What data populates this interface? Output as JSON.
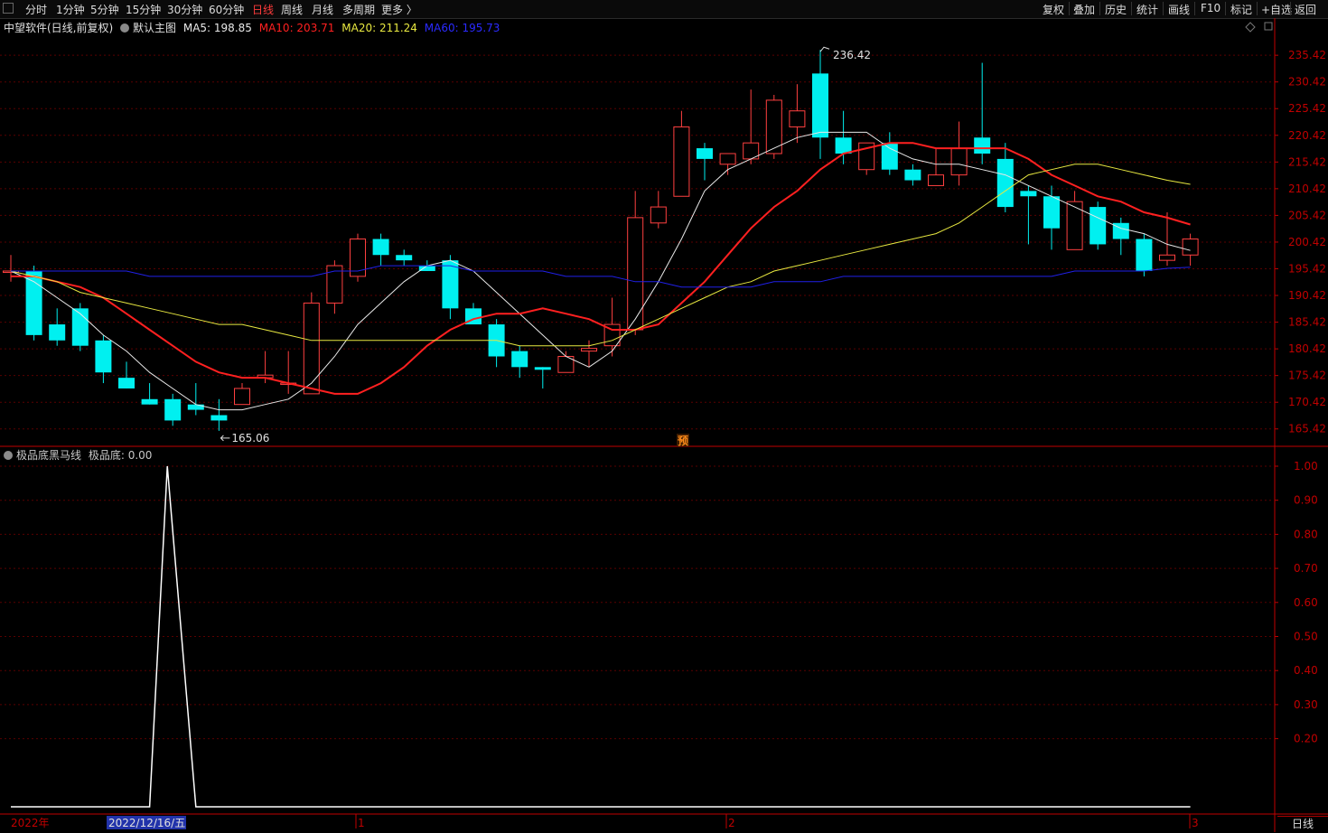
{
  "toolbar": {
    "periods": [
      "分时",
      "1分钟",
      "5分钟",
      "15分钟",
      "30分钟",
      "60分钟",
      "日线",
      "周线",
      "月线",
      "多周期",
      "更多 〉"
    ],
    "active_period": "日线",
    "tools": [
      "复权",
      "叠加",
      "历史",
      "统计",
      "画线",
      "F10",
      "标记",
      "+自选",
      "返回"
    ]
  },
  "info": {
    "stock": "中望软件(日线,前复权)",
    "template": "默认主图",
    "ma5": "MA5: 198.85",
    "ma10": "MA10: 203.71",
    "ma20": "MA20: 211.24",
    "ma60": "MA60: 195.73"
  },
  "indicator": {
    "name": "极品底黑马线",
    "value": "极品底: 0.00"
  },
  "colors": {
    "up": "#ff4040",
    "down": "#00f0f0",
    "ma5": "#e8e8e8",
    "ma10": "#ff2020",
    "ma20": "#e8e840",
    "ma60": "#2020e8",
    "axis": "#c00000"
  },
  "chart_data": [
    {
      "type": "candlestick",
      "title": "中望软件(日线,前复权)",
      "yaxis_ticks": [
        "235.42",
        "230.42",
        "225.42",
        "220.42",
        "215.42",
        "210.42",
        "205.42",
        "200.42",
        "195.42",
        "190.42",
        "185.42",
        "180.42",
        "175.42",
        "170.42",
        "165.42"
      ],
      "ylim": [
        162.5,
        239
      ],
      "annotations": {
        "high_label": "236.42",
        "low_label": "165.06",
        "pre_marker": "预"
      },
      "candles": [
        {
          "o": 195,
          "h": 198,
          "l": 193,
          "c": 195
        },
        {
          "o": 195,
          "h": 196,
          "l": 182,
          "c": 183
        },
        {
          "o": 185,
          "h": 188,
          "l": 181,
          "c": 182
        },
        {
          "o": 188,
          "h": 189,
          "l": 180,
          "c": 181
        },
        {
          "o": 182,
          "h": 183,
          "l": 174,
          "c": 176
        },
        {
          "o": 175,
          "h": 178,
          "l": 173,
          "c": 173
        },
        {
          "o": 171,
          "h": 174,
          "l": 170,
          "c": 170
        },
        {
          "o": 171,
          "h": 172,
          "l": 166,
          "c": 167
        },
        {
          "o": 170,
          "h": 174,
          "l": 168,
          "c": 169
        },
        {
          "o": 168,
          "h": 171,
          "l": 165.06,
          "c": 167
        },
        {
          "o": 170,
          "h": 174,
          "l": 170,
          "c": 173
        },
        {
          "o": 175,
          "h": 180,
          "l": 174,
          "c": 175.5
        },
        {
          "o": 174,
          "h": 180,
          "l": 172,
          "c": 174
        },
        {
          "o": 172,
          "h": 191,
          "l": 172,
          "c": 189
        },
        {
          "o": 189,
          "h": 197,
          "l": 187,
          "c": 196
        },
        {
          "o": 194,
          "h": 202,
          "l": 193,
          "c": 201
        },
        {
          "o": 201,
          "h": 202,
          "l": 196,
          "c": 198
        },
        {
          "o": 198,
          "h": 199,
          "l": 196,
          "c": 197
        },
        {
          "o": 196,
          "h": 197,
          "l": 195,
          "c": 195
        },
        {
          "o": 197,
          "h": 198,
          "l": 186,
          "c": 188
        },
        {
          "o": 188,
          "h": 189,
          "l": 185,
          "c": 185
        },
        {
          "o": 185,
          "h": 186,
          "l": 177,
          "c": 179
        },
        {
          "o": 180,
          "h": 181,
          "l": 175,
          "c": 177
        },
        {
          "o": 177,
          "h": 177,
          "l": 173,
          "c": 176.5
        },
        {
          "o": 176,
          "h": 180,
          "l": 176,
          "c": 179
        },
        {
          "o": 180,
          "h": 182,
          "l": 177,
          "c": 180.5
        },
        {
          "o": 181,
          "h": 190,
          "l": 179,
          "c": 185
        },
        {
          "o": 184,
          "h": 210,
          "l": 183,
          "c": 205
        },
        {
          "o": 204,
          "h": 210,
          "l": 203,
          "c": 207
        },
        {
          "o": 209,
          "h": 225,
          "l": 209,
          "c": 222
        },
        {
          "o": 218,
          "h": 219,
          "l": 212,
          "c": 216
        },
        {
          "o": 215,
          "h": 217,
          "l": 213,
          "c": 217
        },
        {
          "o": 216,
          "h": 229,
          "l": 215,
          "c": 219
        },
        {
          "o": 217,
          "h": 228,
          "l": 216,
          "c": 227
        },
        {
          "o": 222,
          "h": 230,
          "l": 219,
          "c": 225
        },
        {
          "o": 232,
          "h": 236.42,
          "l": 216,
          "c": 220
        },
        {
          "o": 220,
          "h": 225,
          "l": 215,
          "c": 217
        },
        {
          "o": 214,
          "h": 219,
          "l": 213,
          "c": 219
        },
        {
          "o": 219,
          "h": 221,
          "l": 213,
          "c": 214
        },
        {
          "o": 214,
          "h": 215,
          "l": 211,
          "c": 212
        },
        {
          "o": 211,
          "h": 218,
          "l": 211,
          "c": 213
        },
        {
          "o": 213,
          "h": 223,
          "l": 211,
          "c": 218
        },
        {
          "o": 220,
          "h": 234,
          "l": 215,
          "c": 217
        },
        {
          "o": 216,
          "h": 219,
          "l": 206,
          "c": 207
        },
        {
          "o": 210,
          "h": 211,
          "l": 200,
          "c": 209
        },
        {
          "o": 209,
          "h": 211,
          "l": 199,
          "c": 203
        },
        {
          "o": 199,
          "h": 210,
          "l": 199,
          "c": 208
        },
        {
          "o": 207,
          "h": 208,
          "l": 199,
          "c": 200
        },
        {
          "o": 204,
          "h": 205,
          "l": 198,
          "c": 201
        },
        {
          "o": 201,
          "h": 202,
          "l": 194,
          "c": 195
        },
        {
          "o": 197,
          "h": 206,
          "l": 196,
          "c": 198
        },
        {
          "o": 198,
          "h": 202,
          "l": 196,
          "c": 201
        }
      ],
      "series": [
        {
          "name": "MA5",
          "values": [
            195,
            193,
            190,
            187,
            183,
            180,
            176,
            173,
            170,
            169,
            169,
            170,
            171,
            174,
            179,
            185,
            189,
            193,
            196,
            197,
            195,
            191,
            187,
            183,
            179,
            177,
            180,
            186,
            193,
            201,
            210,
            214,
            216,
            218,
            220,
            221,
            221,
            221,
            218,
            216,
            215,
            215,
            214,
            213,
            211,
            209,
            207,
            205,
            203,
            202,
            200,
            198.85
          ]
        },
        {
          "name": "MA10",
          "values": [
            194,
            194,
            193,
            192,
            190,
            187,
            184,
            181,
            178,
            176,
            175,
            175,
            174,
            173,
            172,
            172,
            174,
            177,
            181,
            184,
            186,
            187,
            187,
            188,
            187,
            186,
            184,
            184,
            185,
            189,
            193,
            198,
            203,
            207,
            210,
            214,
            217,
            218,
            219,
            219,
            218,
            218,
            218,
            218,
            216,
            213,
            211,
            209,
            208,
            206,
            205,
            203.71
          ]
        },
        {
          "name": "MA20",
          "values": [
            195,
            194,
            193,
            191,
            190,
            189,
            188,
            187,
            186,
            185,
            185,
            184,
            183,
            182,
            182,
            182,
            182,
            182,
            182,
            182,
            182,
            182,
            181,
            181,
            181,
            181,
            182,
            184,
            186,
            188,
            190,
            192,
            193,
            195,
            196,
            197,
            198,
            199,
            200,
            201,
            202,
            204,
            207,
            210,
            213,
            214,
            215,
            215,
            214,
            213,
            212,
            211.24
          ]
        },
        {
          "name": "MA60",
          "values": [
            195,
            195,
            195,
            195,
            195,
            195,
            194,
            194,
            194,
            194,
            194,
            194,
            194,
            194,
            195,
            195,
            196,
            196,
            196,
            196,
            195,
            195,
            195,
            195,
            194,
            194,
            194,
            193,
            193,
            192,
            192,
            192,
            192,
            193,
            193,
            193,
            194,
            194,
            194,
            194,
            194,
            194,
            194,
            194,
            194,
            194,
            195,
            195,
            195,
            195,
            195.5,
            195.73
          ]
        }
      ]
    },
    {
      "type": "line",
      "title": "极品底黑马线",
      "yaxis_ticks": [
        "1.00",
        "0.90",
        "0.80",
        "0.70",
        "0.60",
        "0.50",
        "0.40",
        "0.30",
        "0.20"
      ],
      "ylim": [
        0,
        1.0
      ],
      "series": [
        {
          "name": "极品底",
          "values": [
            0,
            0,
            0,
            0,
            0,
            0,
            0,
            1,
            0,
            0,
            0,
            0,
            0,
            0,
            0,
            0,
            0,
            0,
            0,
            0,
            0,
            0,
            0,
            0,
            0,
            0,
            0,
            0,
            0,
            0,
            0,
            0,
            0,
            0,
            0,
            0,
            0,
            0,
            0,
            0,
            0,
            0,
            0,
            0,
            0,
            0,
            0,
            0,
            0,
            0,
            0,
            0
          ]
        }
      ]
    }
  ],
  "xaxis": {
    "labels": [
      "2022年",
      "2022/12/16/五",
      "1",
      "2",
      "3"
    ]
  },
  "footer": {
    "period": "日线"
  }
}
